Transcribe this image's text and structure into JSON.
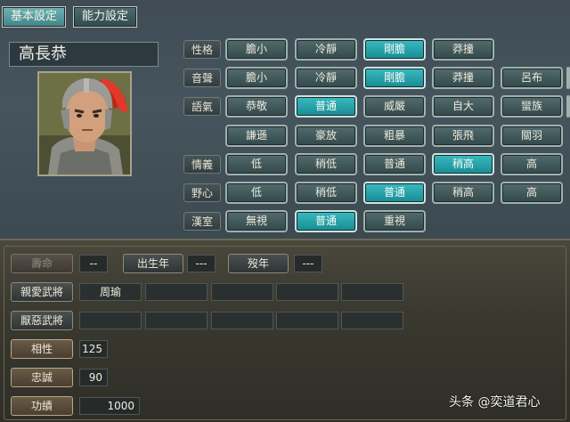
{
  "tabs": {
    "basic": "基本設定",
    "ability": "能力設定"
  },
  "general_name": "高長恭",
  "rows": [
    {
      "id": "personality",
      "label": "性格",
      "options": [
        "膽小",
        "冷靜",
        "剛膽",
        "莽撞"
      ],
      "selected": 2
    },
    {
      "id": "voice",
      "label": "音聲",
      "options": [
        "膽小",
        "冷靜",
        "剛膽",
        "莽撞",
        "呂布"
      ],
      "selected": 2
    },
    {
      "id": "tone",
      "label": "語氣",
      "options": [
        "恭敬",
        "普通",
        "威嚴",
        "自大",
        "蠻族"
      ],
      "selected": 1
    },
    {
      "id": "tone2",
      "label": "",
      "options": [
        "謙遜",
        "豪放",
        "粗暴",
        "張飛",
        "關羽"
      ],
      "selected": -1
    },
    {
      "id": "loyalty",
      "label": "情義",
      "options": [
        "低",
        "稍低",
        "普通",
        "稍高",
        "高"
      ],
      "selected": 3
    },
    {
      "id": "ambition",
      "label": "野心",
      "options": [
        "低",
        "稍低",
        "普通",
        "稍高",
        "高"
      ],
      "selected": 2
    },
    {
      "id": "han",
      "label": "漢室",
      "options": [
        "無視",
        "普通",
        "重視"
      ],
      "selected": 1
    }
  ],
  "lifespan": {
    "label": "壽命",
    "value": "--"
  },
  "birth_year": {
    "label": "出生年",
    "value": "---"
  },
  "death_year": {
    "label": "歿年",
    "value": "---"
  },
  "liked_generals": {
    "label": "親愛武將",
    "slots": [
      "周瑜",
      "",
      "",
      "",
      ""
    ]
  },
  "disliked_generals": {
    "label": "厭惡武將",
    "slots": [
      "",
      "",
      "",
      "",
      ""
    ]
  },
  "compatibility": {
    "label": "相性",
    "value": "125"
  },
  "loyalty_value": {
    "label": "忠誠",
    "value": "90"
  },
  "merit": {
    "label": "功績",
    "value": "1000"
  },
  "watermark": "头条 @奕道君心",
  "colors": {
    "selected": "#1ea3aa",
    "panel": "#46555d",
    "bottom": "#3a3930"
  }
}
